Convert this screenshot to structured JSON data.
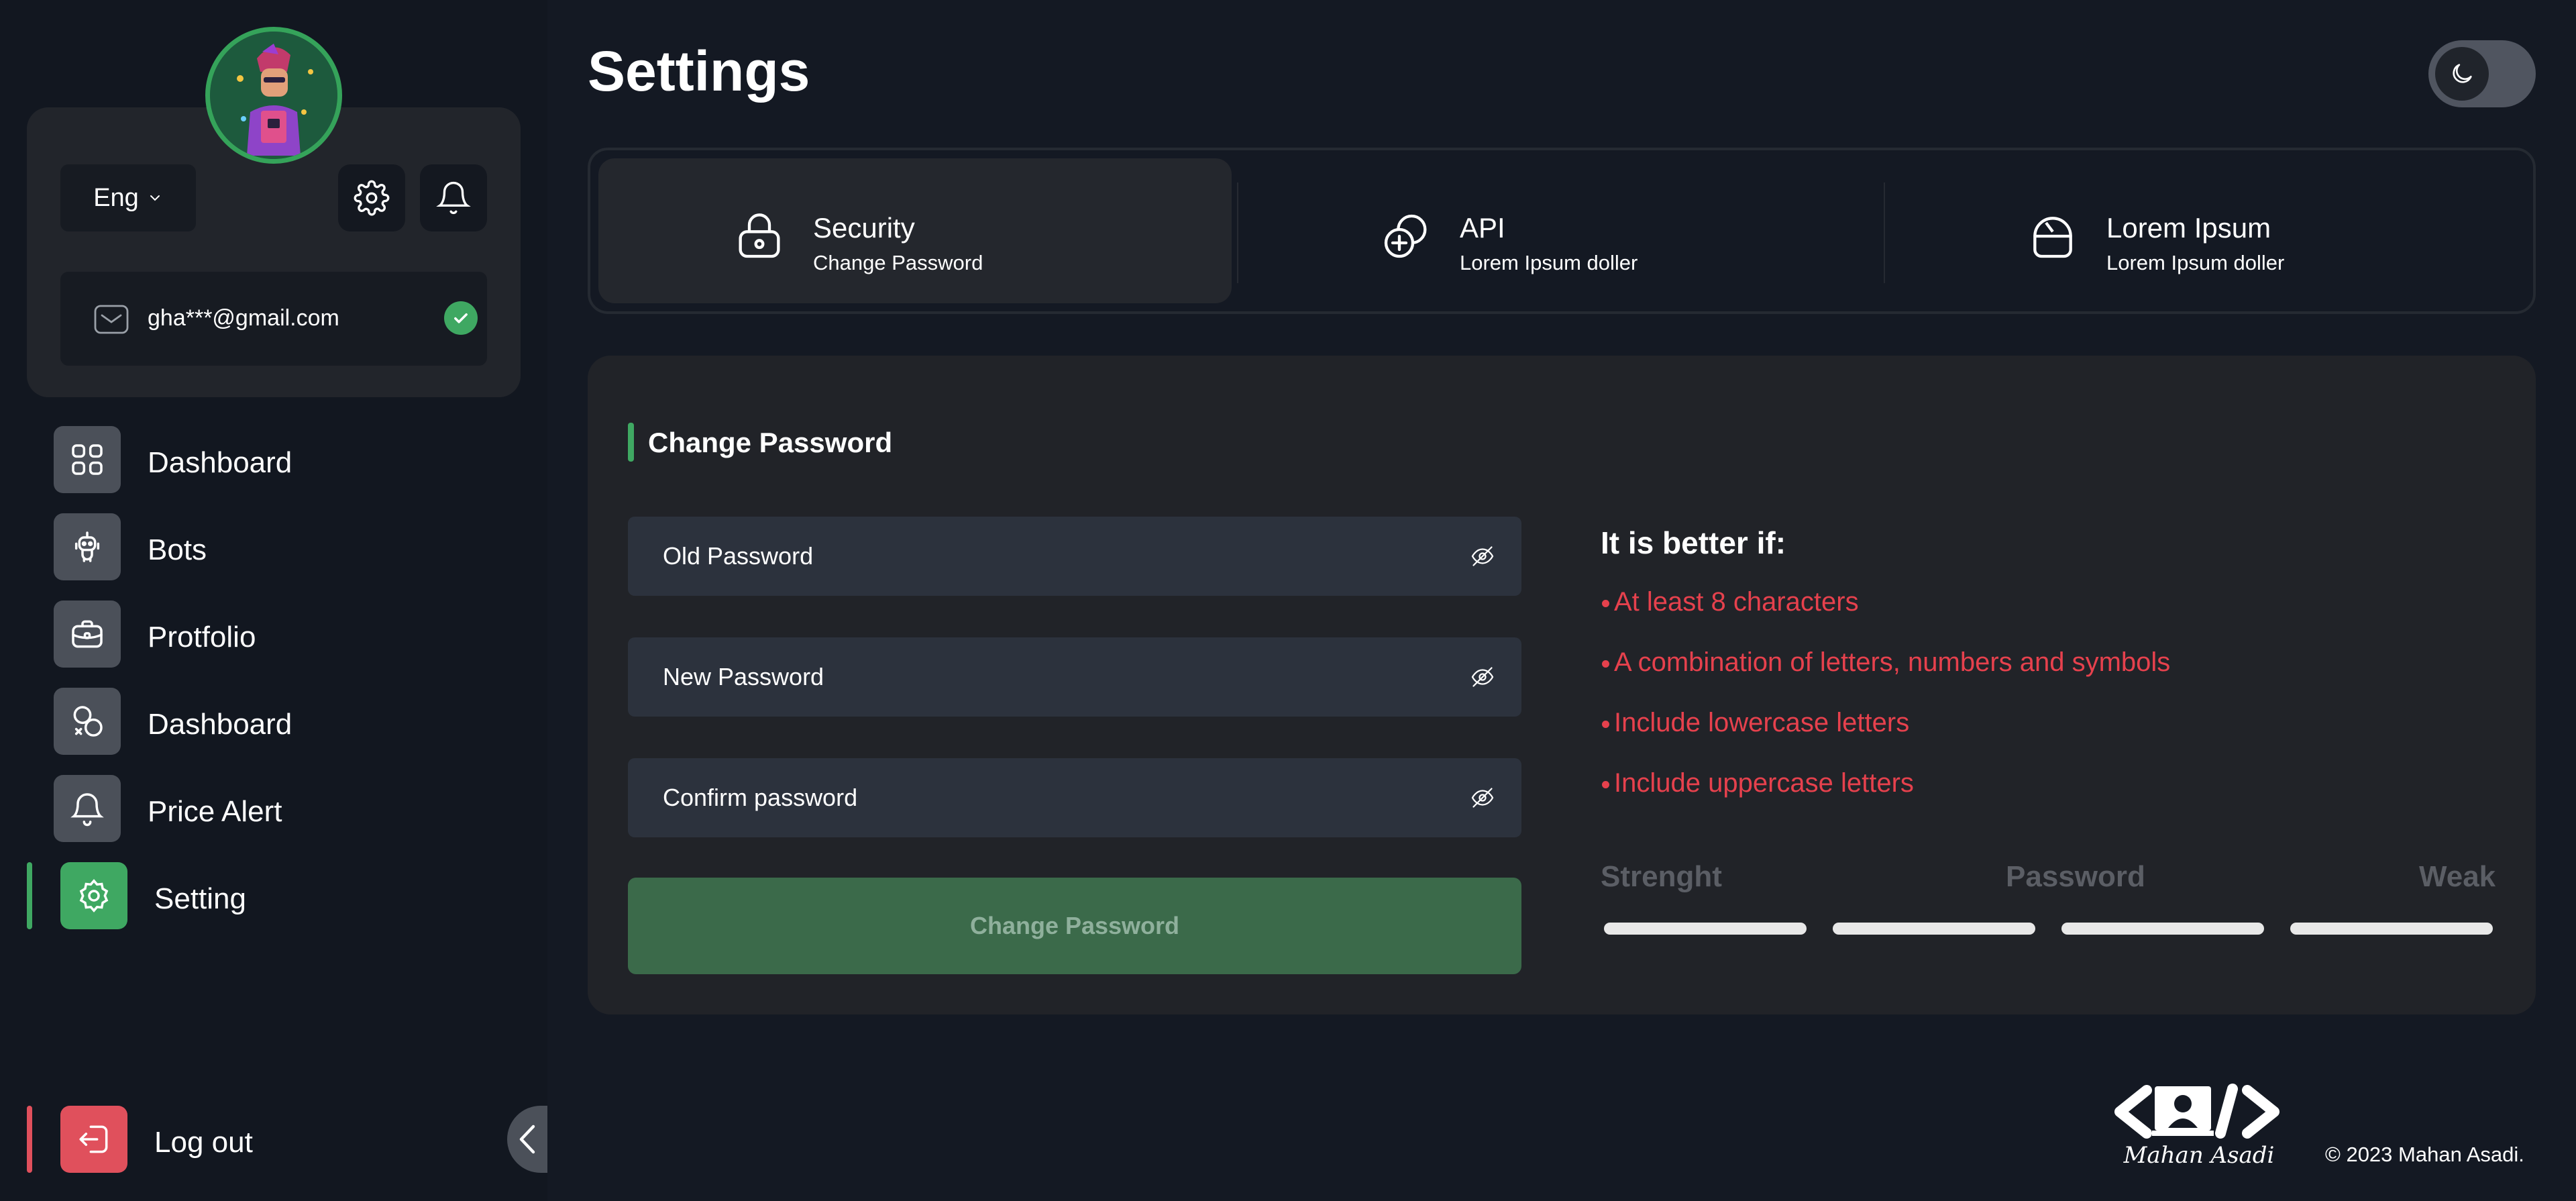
{
  "profile": {
    "language": "Eng",
    "email": "gha***@gmail.com"
  },
  "nav": {
    "items": [
      {
        "label": "Dashboard",
        "icon": "grid-icon"
      },
      {
        "label": "Bots",
        "icon": "robot-icon"
      },
      {
        "label": "Protfolio",
        "icon": "briefcase-icon"
      },
      {
        "label": "Dashboard",
        "icon": "shapes-icon"
      },
      {
        "label": "Price Alert",
        "icon": "bell-icon"
      },
      {
        "label": "Setting",
        "icon": "gear-icon",
        "active": true
      }
    ],
    "logout_label": "Log out"
  },
  "header": {
    "title": "Settings",
    "theme": "dark"
  },
  "tabs": [
    {
      "title": "Security",
      "subtitle": "Change Password",
      "icon": "lock-icon",
      "active": true
    },
    {
      "title": "API",
      "subtitle": "Lorem Ipsum doller",
      "icon": "api-icon"
    },
    {
      "title": "Lorem Ipsum",
      "subtitle": "Lorem Ipsum doller",
      "icon": "bag-icon"
    }
  ],
  "form": {
    "heading": "Change Password",
    "old_placeholder": "Old Password",
    "new_placeholder": "New Password",
    "confirm_placeholder": "Confirm password",
    "submit_label": "Change Password"
  },
  "tips": {
    "title": "It is better if:",
    "items": [
      "At least 8 characters",
      "A combination of letters, numbers and symbols",
      "Include lowercase letters",
      "Include uppercase letters"
    ]
  },
  "strength": {
    "label_left": "Strenght",
    "label_mid": "Password",
    "label_right": "Weak",
    "segments_total": 4
  },
  "footer": {
    "logo_text": "Mahan Asadi",
    "copyright": "© 2023 Mahan Asadi."
  },
  "colors": {
    "accent": "#3fa862",
    "danger": "#e0505c",
    "tip_text": "#e6414d",
    "background": "#141923",
    "panel": "#212328"
  }
}
